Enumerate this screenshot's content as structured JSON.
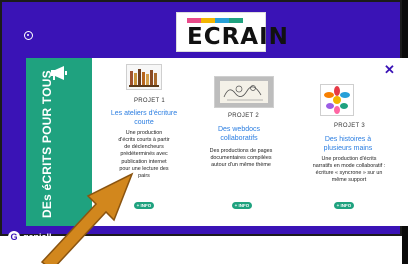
{
  "brand": {
    "logo_text": "ECRAIN",
    "logo_stripe_colors": [
      "#e84b8a",
      "#f2b500",
      "#27a0d8",
      "#1fa27f"
    ],
    "footer_text": "geniall"
  },
  "colors": {
    "stage_bg": "#3a13b6",
    "side_accent": "#1fa27f",
    "title_blue": "#2a7de1",
    "arrow": "#d2871d"
  },
  "panel": {
    "side_title": "DEs éCRITS POUR TOUS",
    "side_icon": "megaphone-icon",
    "close_label": "✕"
  },
  "projects": [
    {
      "project_label": "PROJET 1",
      "title": "Les ateliers d'écriture courte",
      "description": "Une production d'écrits courts à partir de déclencheurs prédéterminés avec publication internet pour une lecture des pairs",
      "info_label": "+ INFO",
      "thumb_icon": "books-icon"
    },
    {
      "project_label": "PROJET 2",
      "title": "Des webdocs collaboratifs",
      "description": "Des productions de pages documentaires compilées autour d'un même thème",
      "info_label": "+ INFO",
      "thumb_icon": "sketch-drawing-icon"
    },
    {
      "project_label": "PROJET 3",
      "title": "Des histoires à plusieurs mains",
      "description": "Une production d'écrits narratifs en mode collaboratif : écriture « syncrone » sur un même support",
      "info_label": "+ INFO",
      "thumb_icon": "colorful-hands-icon"
    }
  ]
}
